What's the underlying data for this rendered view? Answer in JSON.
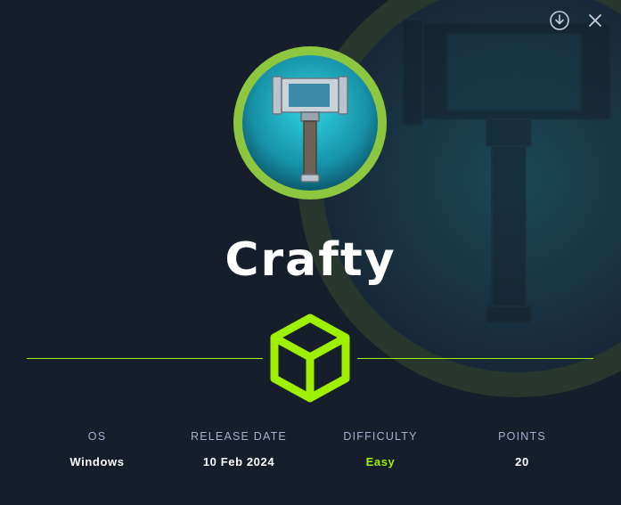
{
  "machine": {
    "name": "Crafty",
    "os_label": "OS",
    "os_value": "Windows",
    "release_label": "RELEASE DATE",
    "release_value": "10 Feb 2024",
    "difficulty_label": "DIFFICULTY",
    "difficulty_value": "Easy",
    "points_label": "POINTS",
    "points_value": "20"
  },
  "icons": {
    "download": "download-icon",
    "close": "close-icon",
    "avatar": "hammer-icon",
    "badge": "cube-icon"
  },
  "colors": {
    "background": "#161d2b",
    "accent": "#9fef00",
    "label": "#a4b1cd",
    "text": "#ffffff",
    "avatar_ring": "#8dc63f",
    "avatar_fill": "#1ea6b8"
  }
}
